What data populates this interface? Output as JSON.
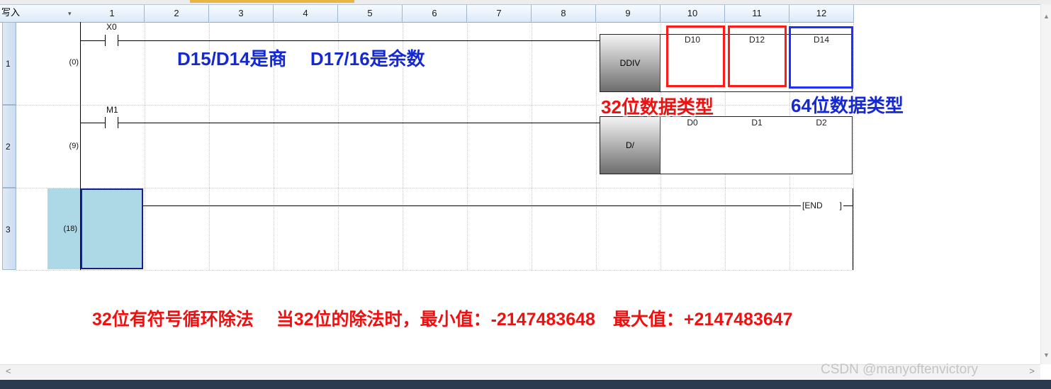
{
  "toolbar": {
    "mode_label": "写入",
    "dropdown_glyph": "▾"
  },
  "columns": [
    "1",
    "2",
    "3",
    "4",
    "5",
    "6",
    "7",
    "8",
    "9",
    "10",
    "11",
    "12"
  ],
  "rows": [
    {
      "num": "1",
      "step": "(0)"
    },
    {
      "num": "2",
      "step": "(9)"
    },
    {
      "num": "3",
      "step": "(18)"
    }
  ],
  "rung1": {
    "contact": "X0",
    "instruction": "DDIV",
    "operands": [
      "D10",
      "D12",
      "D14"
    ]
  },
  "rung2": {
    "contact": "M1",
    "instruction": "D/",
    "operands": [
      "D0",
      "D1",
      "D2"
    ]
  },
  "rung3": {
    "end_label": "[END",
    "end_close": "]"
  },
  "annotations": {
    "quotient_remainder": "D15/D14是商　 D17/16是余数",
    "type32": "32位数据类型",
    "type64": "64位数据类型",
    "bottom_note": "32位有符号循环除法　 当32位的除法时，最小值：-2147483648　最大值：+2147483647"
  },
  "colors": {
    "red_box": "#ff1a1a",
    "blue_box": "#1e2fff",
    "cursor_fill": "#add8e6"
  },
  "scroll": {
    "left_arrow": "<",
    "right_arrow": ">"
  },
  "watermark": "CSDN @manyoftenvictory"
}
